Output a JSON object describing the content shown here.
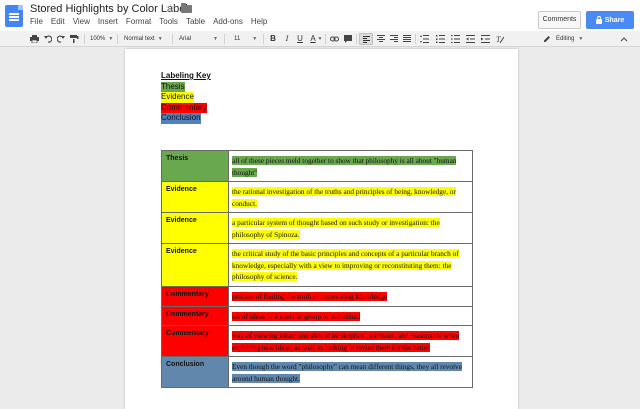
{
  "app": {
    "title": "Stored Highlights by Color Label",
    "menu": [
      "File",
      "Edit",
      "View",
      "Insert",
      "Format",
      "Tools",
      "Table",
      "Add-ons",
      "Help"
    ],
    "comments_label": "Comments",
    "share_label": "Share"
  },
  "toolbar": {
    "zoom": "100%",
    "style": "Normal text",
    "font": "Arial",
    "size": "11",
    "bold": "B",
    "italic": "I",
    "underline": "U",
    "text_color": "A",
    "mode": "Editing"
  },
  "colors": {
    "Thesis": "#6aa84f",
    "Evidence": "#ffff00",
    "Commentary": "#ff0000",
    "Conclusion": "#4f81bd",
    "ConclusionCell": "#6188ac"
  },
  "key": {
    "title": "Labeling Key",
    "items": [
      {
        "label": "Thesis",
        "color": "#6aa84f"
      },
      {
        "label": "Evidence",
        "color": "#ffff00"
      },
      {
        "label": "Commentary",
        "color": "#ff0000"
      },
      {
        "label": "Conclusion",
        "color": "#4f81bd"
      }
    ]
  },
  "table": {
    "rows": [
      {
        "label": "Thesis",
        "text": "all of these pieces meld together to show that philosophy is all about \"human thought\""
      },
      {
        "label": "Evidence",
        "text": "the rational investigation of the truths and principles of being, knowledge, or conduct."
      },
      {
        "label": "Evidence",
        "text": "a particular system of thought based on such study or investigation: the philosophy of Spinoza."
      },
      {
        "label": "Evidence",
        "text": "the critical study of the basic principles and concepts of a particular branch of knowledge, especially with a view to improving or reconstituting them: the philosophy of science."
      },
      {
        "label": "Commentary",
        "text": "process of finding the truth or uncovering knowledge"
      },
      {
        "label": "Commentary",
        "text": "set of ideas of a specific group or individual"
      },
      {
        "label": "Commentary",
        "text": "way of viewing ideas: one should be skeptical, cautious, and reasonable when exploring new ideas, as well as looking to revise them for the better"
      },
      {
        "label": "Conclusion",
        "text": "Even though the word \"philosophy\" can mean different things, they all revolve around human thought."
      }
    ]
  }
}
